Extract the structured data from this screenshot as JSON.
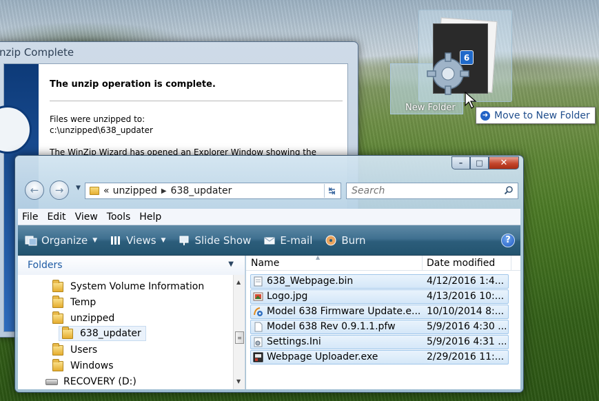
{
  "winzip": {
    "title": "nzip Complete",
    "heading": "The unzip operation is complete.",
    "unzipped_to_label": "Files were unzipped to:",
    "unzipped_to_path": "c:\\unzipped\\638_updater",
    "explorer_note": "The WinZip Wizard has opened an Explorer Window showing the"
  },
  "explorer": {
    "caption": {
      "minimize": "–",
      "maximize": "□",
      "close": "✕"
    },
    "address": {
      "overflow": "«",
      "crumbs": [
        "unzipped",
        "638_updater"
      ]
    },
    "search": {
      "placeholder": "Search"
    },
    "menu": [
      "File",
      "Edit",
      "View",
      "Tools",
      "Help"
    ],
    "commands": {
      "organize": "Organize",
      "views": "Views",
      "slideshow": "Slide Show",
      "email": "E-mail",
      "burn": "Burn"
    },
    "folders_pane": {
      "header": "Folders",
      "items": [
        "System Volume Information",
        "Temp",
        "unzipped",
        "638_updater",
        "Users",
        "Windows",
        "RECOVERY (D:)"
      ]
    },
    "columns": {
      "name": "Name",
      "date": "Date modified"
    },
    "files": [
      {
        "name": "638_Webpage.bin",
        "date": "4/12/2016 1:4...",
        "icon": "bin-file-icon"
      },
      {
        "name": "Logo.jpg",
        "date": "4/13/2016 10:...",
        "icon": "image-file-icon"
      },
      {
        "name": "Model 638 Firmware Update.e...",
        "date": "10/10/2014 8:...",
        "icon": "installer-icon"
      },
      {
        "name": "Model 638 Rev 0.9.1.1.pfw",
        "date": "5/9/2016 4:30 ...",
        "icon": "blank-file-icon"
      },
      {
        "name": "Settings.Ini",
        "date": "5/9/2016 4:31 ...",
        "icon": "settings-file-icon"
      },
      {
        "name": "Webpage Uploader.exe",
        "date": "2/29/2016 11:...",
        "icon": "exe-file-icon"
      }
    ]
  },
  "drag": {
    "count": "6",
    "target_label": "New Folder",
    "tooltip": "Move to New Folder"
  },
  "colors": {
    "accent": "#1f69c9",
    "command_bar": "#2c5d7b",
    "selection": "#d4e7f8",
    "close_button": "#c4452c"
  }
}
